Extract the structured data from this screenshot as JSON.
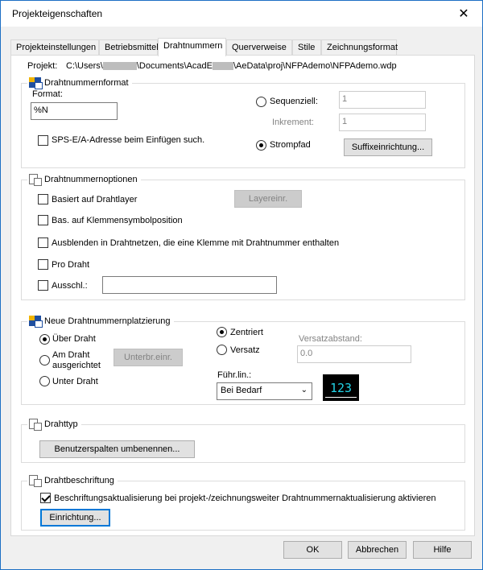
{
  "window": {
    "title": "Projekteigenschaften"
  },
  "tabs": [
    "Projekteinstellungen",
    "Betriebsmittel",
    "Drahtnummern",
    "Querverweise",
    "Stile",
    "Zeichnungsformat"
  ],
  "project": {
    "label": "Projekt:",
    "path_prefix": "C:\\Users\\",
    "path_mid": "\\Documents\\AcadE",
    "path_suffix": "\\AeData\\proj\\NFPAdemo\\NFPAdemo.wdp"
  },
  "wirenumber_format": {
    "title": "Drahtnummernformat",
    "format_label": "Format:",
    "format_value": "%N",
    "sequential_label": "Sequenziell:",
    "sequential_value": "1",
    "increment_label": "Inkrement:",
    "increment_value": "1",
    "plc_label": "SPS-E/A-Adresse beim Einfügen such.",
    "line_ref_label": "Strompfad",
    "suffix_button": "Suffixeinrichtung..."
  },
  "wirenumber_options": {
    "title": "Drahtnummernoptionen",
    "by_layer_label": "Basiert auf Drahtlayer",
    "layer_button": "Layereinr.",
    "terminal_label": "Bas. auf Klemmensymbolposition",
    "hide_label": "Ausblenden in Drahtnetzen, die eine Klemme mit Drahtnummer enthalten",
    "per_wire_label": "Pro Draht",
    "exclude_label": "Ausschl.:",
    "exclude_value": ""
  },
  "placement": {
    "title": "Neue Drahtnummernplatzierung",
    "above_label": "Über Draht",
    "inline_label_1": "Am Draht",
    "inline_label_2": "ausgerichtet",
    "gap_button": "Unterbr.einr.",
    "below_label": "Unter Draht",
    "centered_label": "Zentriert",
    "offset_label": "Versatz",
    "offset_dist_label": "Versatzabstand:",
    "offset_dist_value": "0.0",
    "leader_label": "Führ.lin.:",
    "leader_value": "Bei Bedarf",
    "preview_text": "123",
    "preview_color": "#22d3e6"
  },
  "wiretype": {
    "title": "Drahttyp",
    "rename_button": "Benutzerspalten umbenennen..."
  },
  "wire_labels": {
    "title": "Drahtbeschriftung",
    "update_label": "Beschriftungsaktualisierung bei projekt-/zeichnungsweiter Drahtnummernaktualisierung aktivieren",
    "setup_button": "Einrichtung..."
  },
  "footer": {
    "ok": "OK",
    "cancel": "Abbrechen",
    "help": "Hilfe"
  }
}
